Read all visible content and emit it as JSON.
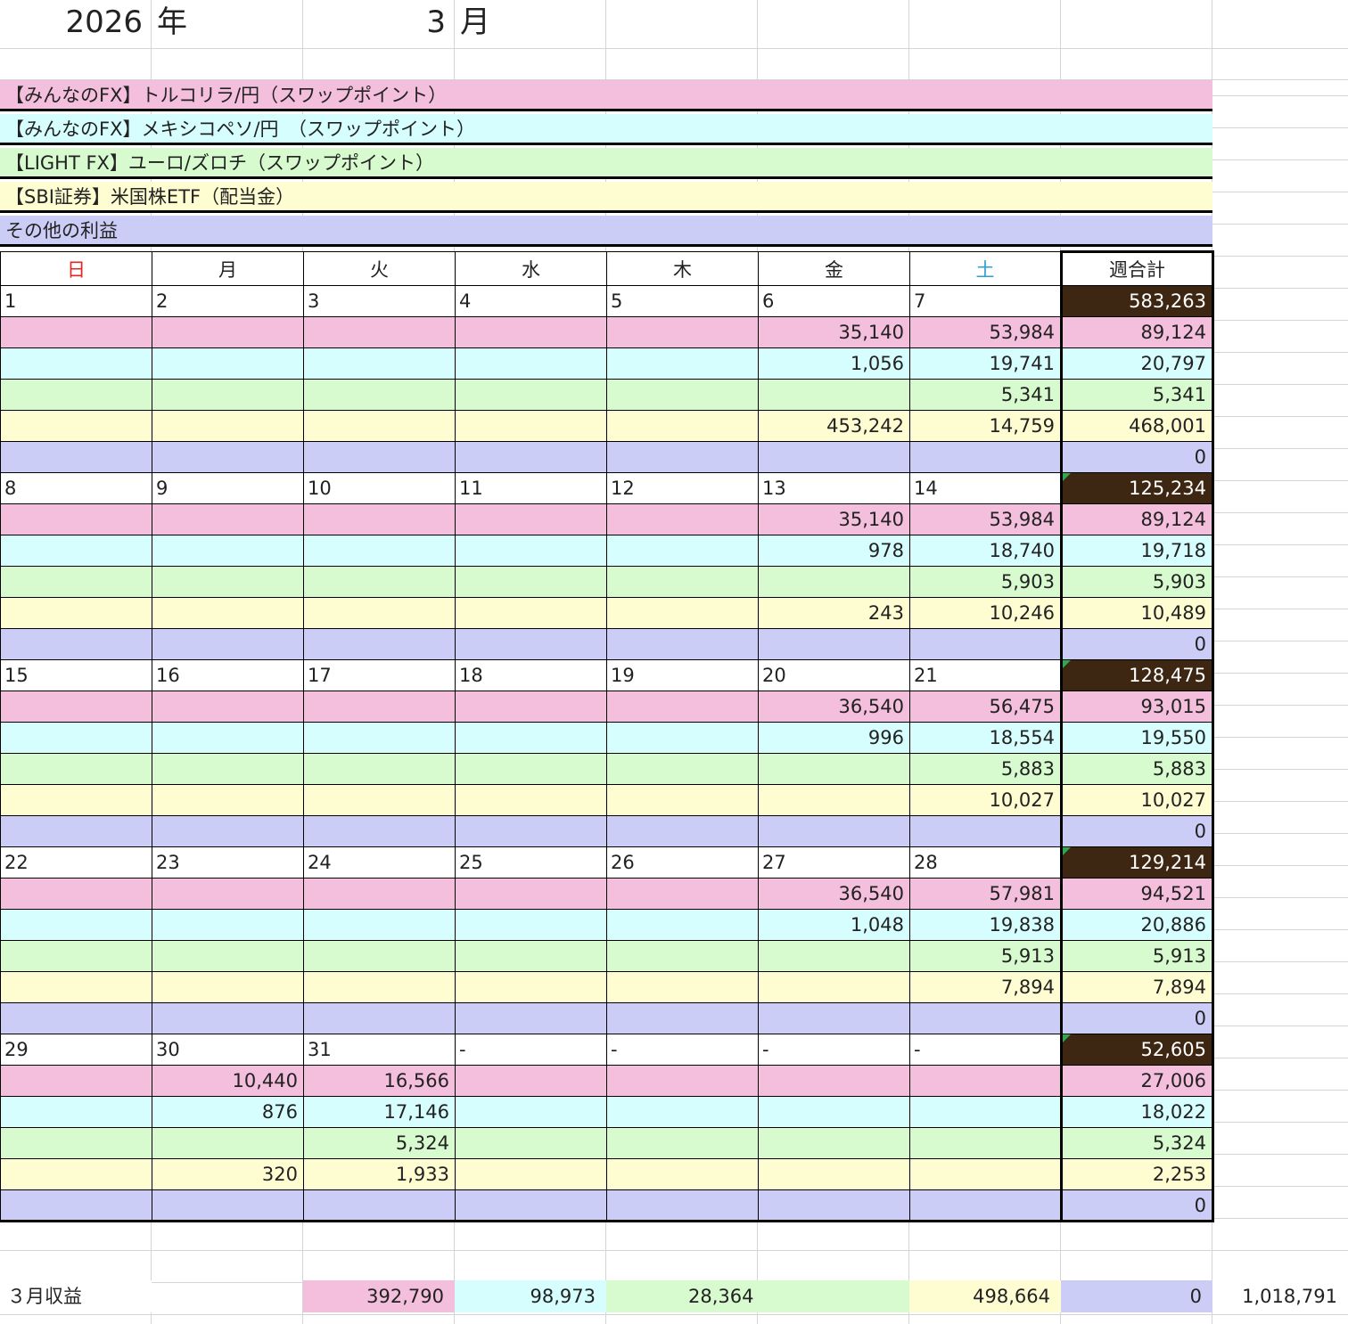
{
  "header": {
    "year": "2026",
    "year_unit": "年",
    "month": "3",
    "month_unit": "月"
  },
  "colors": {
    "pink": "#f4bedd",
    "cyan": "#d6fefe",
    "green": "#d7fbce",
    "yellow": "#fefdd2",
    "lavender": "#cccdf6",
    "week_total_bg": "#3d2612"
  },
  "categories": [
    {
      "label": "【みんなのFX】トルコリラ/円（スワップポイント）"
    },
    {
      "label": "【みんなのFX】メキシコペソ/円　（スワップポイント）"
    },
    {
      "label": "【LIGHT FX】ユーロ/ズロチ（スワップポイント）"
    },
    {
      "label": "【SBI証券】米国株ETF（配当金）"
    },
    {
      "label": "その他の利益"
    }
  ],
  "weekdays": [
    "日",
    "月",
    "火",
    "水",
    "木",
    "金",
    "土"
  ],
  "weekday_colors": [
    "#e8261e",
    "#222222",
    "#222222",
    "#222222",
    "#222222",
    "#222222",
    "#2aa0d8"
  ],
  "week_total_label": "週合計",
  "weeks": [
    {
      "dates": [
        "1",
        "2",
        "3",
        "4",
        "5",
        "6",
        "7"
      ],
      "total": "583,263",
      "rows": [
        {
          "cells": [
            "",
            "",
            "",
            "",
            "",
            "35,140",
            "53,984"
          ],
          "total": "89,124"
        },
        {
          "cells": [
            "",
            "",
            "",
            "",
            "",
            "1,056",
            "19,741"
          ],
          "total": "20,797"
        },
        {
          "cells": [
            "",
            "",
            "",
            "",
            "",
            "",
            "5,341"
          ],
          "total": "5,341"
        },
        {
          "cells": [
            "",
            "",
            "",
            "",
            "",
            "453,242",
            "14,759"
          ],
          "total": "468,001"
        },
        {
          "cells": [
            "",
            "",
            "",
            "",
            "",
            "",
            ""
          ],
          "total": "0"
        }
      ]
    },
    {
      "dates": [
        "8",
        "9",
        "10",
        "11",
        "12",
        "13",
        "14"
      ],
      "total": "125,234",
      "rows": [
        {
          "cells": [
            "",
            "",
            "",
            "",
            "",
            "35,140",
            "53,984"
          ],
          "total": "89,124"
        },
        {
          "cells": [
            "",
            "",
            "",
            "",
            "",
            "978",
            "18,740"
          ],
          "total": "19,718"
        },
        {
          "cells": [
            "",
            "",
            "",
            "",
            "",
            "",
            "5,903"
          ],
          "total": "5,903"
        },
        {
          "cells": [
            "",
            "",
            "",
            "",
            "",
            "243",
            "10,246"
          ],
          "total": "10,489"
        },
        {
          "cells": [
            "",
            "",
            "",
            "",
            "",
            "",
            ""
          ],
          "total": "0"
        }
      ]
    },
    {
      "dates": [
        "15",
        "16",
        "17",
        "18",
        "19",
        "20",
        "21"
      ],
      "total": "128,475",
      "rows": [
        {
          "cells": [
            "",
            "",
            "",
            "",
            "",
            "36,540",
            "56,475"
          ],
          "total": "93,015"
        },
        {
          "cells": [
            "",
            "",
            "",
            "",
            "",
            "996",
            "18,554"
          ],
          "total": "19,550"
        },
        {
          "cells": [
            "",
            "",
            "",
            "",
            "",
            "",
            "5,883"
          ],
          "total": "5,883"
        },
        {
          "cells": [
            "",
            "",
            "",
            "",
            "",
            "",
            "10,027"
          ],
          "total": "10,027"
        },
        {
          "cells": [
            "",
            "",
            "",
            "",
            "",
            "",
            ""
          ],
          "total": "0"
        }
      ]
    },
    {
      "dates": [
        "22",
        "23",
        "24",
        "25",
        "26",
        "27",
        "28"
      ],
      "total": "129,214",
      "rows": [
        {
          "cells": [
            "",
            "",
            "",
            "",
            "",
            "36,540",
            "57,981"
          ],
          "total": "94,521"
        },
        {
          "cells": [
            "",
            "",
            "",
            "",
            "",
            "1,048",
            "19,838"
          ],
          "total": "20,886"
        },
        {
          "cells": [
            "",
            "",
            "",
            "",
            "",
            "",
            "5,913"
          ],
          "total": "5,913"
        },
        {
          "cells": [
            "",
            "",
            "",
            "",
            "",
            "",
            "7,894"
          ],
          "total": "7,894"
        },
        {
          "cells": [
            "",
            "",
            "",
            "",
            "",
            "",
            ""
          ],
          "total": "0"
        }
      ]
    },
    {
      "dates": [
        "29",
        "30",
        "31",
        "-",
        "-",
        "-",
        "-"
      ],
      "total": "52,605",
      "rows": [
        {
          "cells": [
            "",
            "10,440",
            "16,566",
            "",
            "",
            "",
            ""
          ],
          "total": "27,006"
        },
        {
          "cells": [
            "",
            "876",
            "17,146",
            "",
            "",
            "",
            ""
          ],
          "total": "18,022"
        },
        {
          "cells": [
            "",
            "",
            "5,324",
            "",
            "",
            "",
            ""
          ],
          "total": "5,324"
        },
        {
          "cells": [
            "",
            "320",
            "1,933",
            "",
            "",
            "",
            ""
          ],
          "total": "2,253"
        },
        {
          "cells": [
            "",
            "",
            "",
            "",
            "",
            "",
            ""
          ],
          "total": "0"
        }
      ]
    }
  ],
  "summary": {
    "label": "３月収益",
    "pink": "392,790",
    "cyan": "98,973",
    "green": "28,364",
    "yellow": "498,664",
    "lavender": "0",
    "grand_total": "1,018,791"
  }
}
